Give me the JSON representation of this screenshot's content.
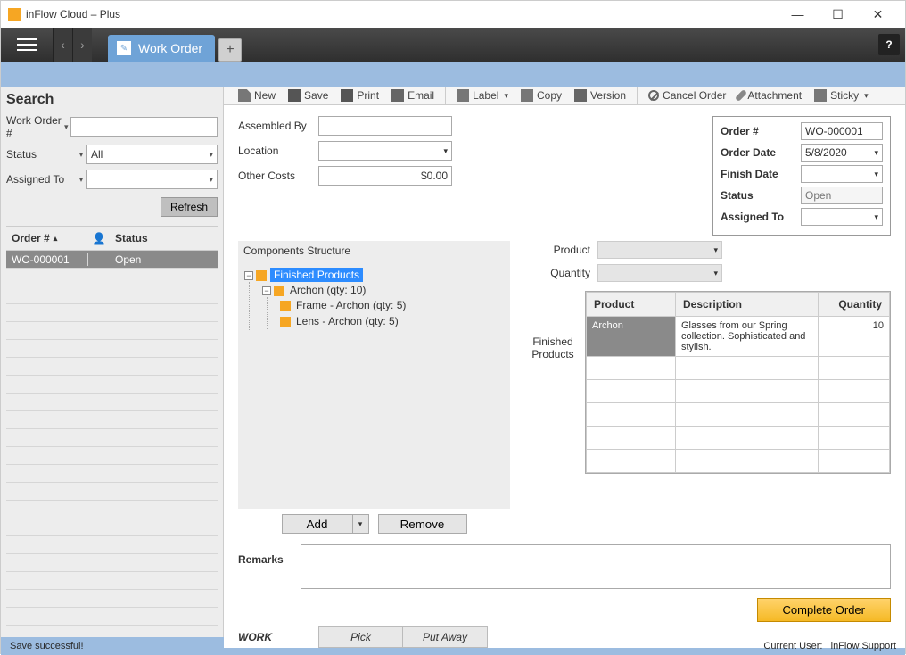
{
  "window": {
    "title": "inFlow Cloud – Plus"
  },
  "tab": {
    "label": "Work Order"
  },
  "toolbar": {
    "new": "New",
    "save": "Save",
    "print": "Print",
    "email": "Email",
    "label": "Label",
    "copy": "Copy",
    "version": "Version",
    "cancel_order": "Cancel Order",
    "attachment": "Attachment",
    "sticky": "Sticky"
  },
  "search": {
    "header": "Search",
    "work_order_label": "Work Order #",
    "work_order_value": "",
    "status_label": "Status",
    "status_value": "All",
    "assigned_label": "Assigned To",
    "assigned_value": "",
    "refresh": "Refresh",
    "columns": {
      "order": "Order #",
      "status": "Status"
    },
    "rows": [
      {
        "order": "WO-000001",
        "status": "Open"
      }
    ]
  },
  "form_left": {
    "assembled_by": {
      "label": "Assembled By",
      "value": ""
    },
    "location": {
      "label": "Location",
      "value": ""
    },
    "other_costs": {
      "label": "Other Costs",
      "value": "$0.00"
    }
  },
  "form_right": {
    "order_no": {
      "label": "Order #",
      "value": "WO-000001"
    },
    "order_date": {
      "label": "Order Date",
      "value": "5/8/2020"
    },
    "finish_date": {
      "label": "Finish Date",
      "value": ""
    },
    "status": {
      "label": "Status",
      "value": "Open"
    },
    "assigned_to": {
      "label": "Assigned To",
      "value": ""
    }
  },
  "components": {
    "title": "Components Structure",
    "root": {
      "label": "Finished Products"
    },
    "child1": {
      "label": "Archon  (qty: 10)"
    },
    "leaf1": {
      "label": "Frame - Archon  (qty: 5)"
    },
    "leaf2": {
      "label": "Lens - Archon  (qty: 5)"
    },
    "add": "Add",
    "remove": "Remove"
  },
  "product_select": {
    "product_label": "Product",
    "product_value": "",
    "quantity_label": "Quantity",
    "quantity_value": ""
  },
  "finished_products": {
    "section_label": "Finished Products",
    "columns": {
      "product": "Product",
      "description": "Description",
      "quantity": "Quantity"
    },
    "rows": [
      {
        "product": "Archon",
        "description": "Glasses from our Spring collection. Sophisticated and stylish.",
        "quantity": "10"
      }
    ]
  },
  "remarks": {
    "label": "Remarks",
    "value": ""
  },
  "complete_order": "Complete Order",
  "bottom_tabs": {
    "stage": "WORK",
    "pick": "Pick",
    "put_away": "Put Away"
  },
  "statusbar": {
    "left": "Save successful!",
    "right_prefix": "Current User:",
    "right_user": "inFlow Support"
  }
}
